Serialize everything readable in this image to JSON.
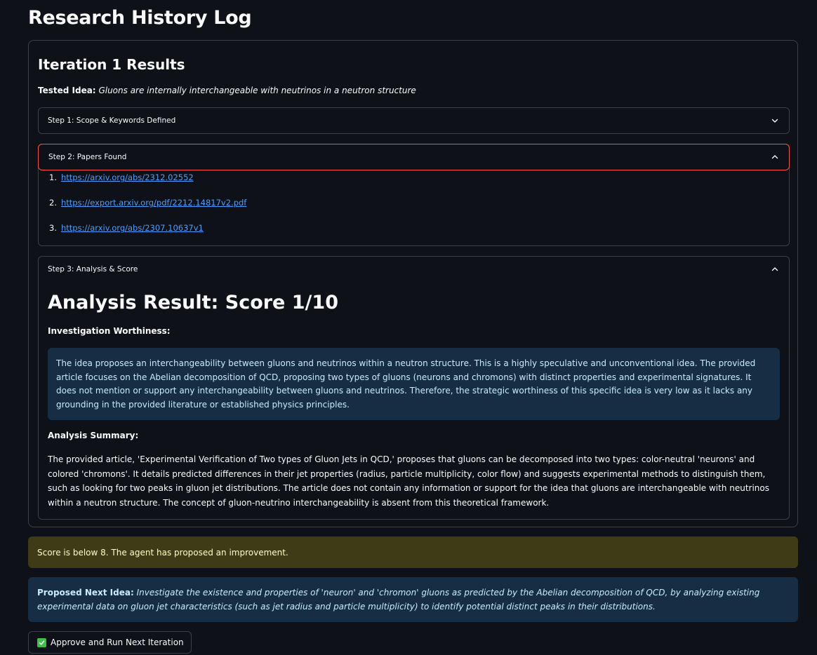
{
  "page": {
    "title": "Research History Log"
  },
  "iteration": {
    "title": "Iteration 1 Results",
    "tested_idea_label": "Tested Idea:",
    "tested_idea_value": "Gluons are internally interchangeable with neutrinos in a neutron structure",
    "steps": {
      "step1": {
        "label": "Step 1: Scope & Keywords Defined",
        "expanded": false
      },
      "step2": {
        "label": "Step 2: Papers Found",
        "expanded": true,
        "papers": [
          {
            "number": "1.",
            "url": "https://arxiv.org/abs/2312.02552"
          },
          {
            "number": "2.",
            "url": "https://export.arxiv.org/pdf/2212.14817v2.pdf"
          },
          {
            "number": "3.",
            "url": "https://arxiv.org/abs/2307.10637v1"
          }
        ]
      },
      "step3": {
        "label": "Step 3: Analysis & Score",
        "expanded": true,
        "result_title": "Analysis Result: Score 1/10",
        "worthiness_heading": "Investigation Worthiness:",
        "worthiness_text": "The idea proposes an interchangeability between gluons and neutrinos within a neutron structure. This is a highly speculative and unconventional idea. The provided article focuses on the Abelian decomposition of QCD, proposing two types of gluons (neurons and chromons) with distinct properties and experimental signatures. It does not mention or support any interchangeability between gluons and neutrinos. Therefore, the strategic worthiness of this specific idea is very low as it lacks any grounding in the provided literature or established physics principles.",
        "summary_heading": "Analysis Summary:",
        "summary_text": "The provided article, 'Experimental Verification of Two types of Gluon Jets in QCD,' proposes that gluons can be decomposed into two types: color-neutral 'neurons' and colored 'chromons'. It details predicted differences in their jet properties (radius, particle multiplicity, color flow) and suggests experimental methods to distinguish them, such as looking for two peaks in gluon jet distributions. The article does not contain any information or support for the idea that gluons are interchangeable with neutrinos within a neutron structure. The concept of gluon-neutrino interchangeability is absent from this theoretical framework."
      }
    }
  },
  "warning": {
    "text": "Score is below 8. The agent has proposed an improvement."
  },
  "next_idea": {
    "label": "Proposed Next Idea:",
    "value": "Investigate the existence and properties of 'neuron' and 'chromon' gluons as predicted by the Abelian decomposition of QCD, by analyzing existing experimental data on gluon jet characteristics (such as jet radius and particle multiplicity) to identify potential distinct peaks in their distributions."
  },
  "actions": {
    "approve_label": "Approve and Run Next Iteration"
  },
  "colors": {
    "background": "#0e1117",
    "link": "#4a9fff",
    "focus_border": "#ff4b4b",
    "info_bg": "#172d43",
    "info_text": "#c7ebff",
    "warning_bg": "#3e3b16",
    "warning_text": "#ffffc2",
    "check_green": "#3dbf4a"
  },
  "icons": {
    "collapsed": "chevron-down-icon",
    "expanded": "chevron-up-icon",
    "approve": "check-mark-icon"
  }
}
